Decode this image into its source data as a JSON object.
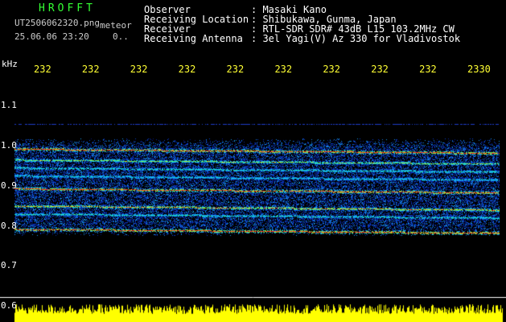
{
  "header": {
    "brand": "HROFFT",
    "filename": "UT2506062320.png",
    "mode": "meteor",
    "datetime": "25.06.06 23:20",
    "extra": "0..",
    "fields": [
      {
        "label": "Observer",
        "value": ": Masaki Kano"
      },
      {
        "label": "Receiving Location",
        "value": ": Shibukawa, Gunma, Japan"
      },
      {
        "label": "Receiver",
        "value": ": RTL-SDR SDR# 43dB L15 103.2MHz CW"
      },
      {
        "label": "Receiving Antenna",
        "value": ": 3el Yagi(V) Az 330 for Vladivostok"
      }
    ]
  },
  "colors": {
    "background": "#000000",
    "yellow": "#ffff00",
    "noise_blue": "#0a1aa8",
    "hot_red": "#ff2020",
    "grid_white": "#ffffff"
  },
  "chart_data": {
    "type": "heatmap",
    "ylabel": "kHz",
    "x_tick_labels": [
      "232",
      "232",
      "232",
      "232",
      "232",
      "232",
      "232",
      "232",
      "232",
      "2330"
    ],
    "ylim": [
      0.6,
      1.15
    ],
    "y_ticks": [
      {
        "value": 1.1,
        "label": "1.1"
      },
      {
        "value": 1.0,
        "label": "1.0"
      },
      {
        "value": 0.9,
        "label": "0.9"
      },
      {
        "value": 0.8,
        "label": "0.8"
      },
      {
        "value": 0.7,
        "label": "0.7"
      },
      {
        "value": 0.6,
        "label": "0.6"
      }
    ],
    "noise_band": [
      0.775,
      1.02
    ],
    "carrier_line_khz": 1.055,
    "bright_lines_khz": [
      {
        "value": 0.992,
        "strength": 1.0
      },
      {
        "value": 0.965,
        "strength": 0.7
      },
      {
        "value": 0.945,
        "strength": 0.55
      },
      {
        "value": 0.925,
        "strength": 0.5
      },
      {
        "value": 0.893,
        "strength": 1.0
      },
      {
        "value": 0.85,
        "strength": 0.85
      },
      {
        "value": 0.83,
        "strength": 0.55
      },
      {
        "value": 0.792,
        "strength": 1.0
      }
    ],
    "grid": false,
    "bottom_spectrum": "yellow noise strip"
  }
}
